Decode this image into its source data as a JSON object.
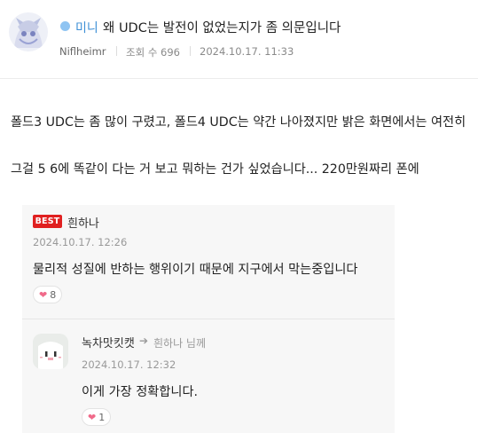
{
  "post": {
    "category": "미니",
    "title": "왜 UDC는 발전이 없었는지가 좀 의문입니다",
    "author": "Niflheimr",
    "views": "조회 수 696",
    "date": "2024.10.17. 11:33",
    "body": [
      "폴드3 UDC는 좀 많이 구렸고, 폴드4 UDC는 약간 나아졌지만 밝은 화면에서는 여전히",
      "그걸 5 6에 똑같이 다는 거 보고 뭐하는 건가 싶었습니다... 220만원짜리 폰에"
    ]
  },
  "comments": {
    "best_label": "BEST",
    "best": {
      "author": "흰하나",
      "date": "2024.10.17. 12:26",
      "text": "물리적 성질에 반하는 행위이기 때문에 지구에서 막는중입니다",
      "likes": "8"
    },
    "reply": {
      "author": "녹차맛킷캣",
      "target": "흰하나 님께",
      "date": "2024.10.17. 12:32",
      "text": "이게 가장 정확합니다.",
      "likes": "1"
    }
  },
  "icons": {
    "like": "heart-icon",
    "reply": "reply-arrow-icon"
  },
  "colors": {
    "best_badge": "#e02020",
    "category_dot": "#8fc4f2",
    "category_text": "#3d8fd6",
    "heart": "#f06a8a"
  }
}
